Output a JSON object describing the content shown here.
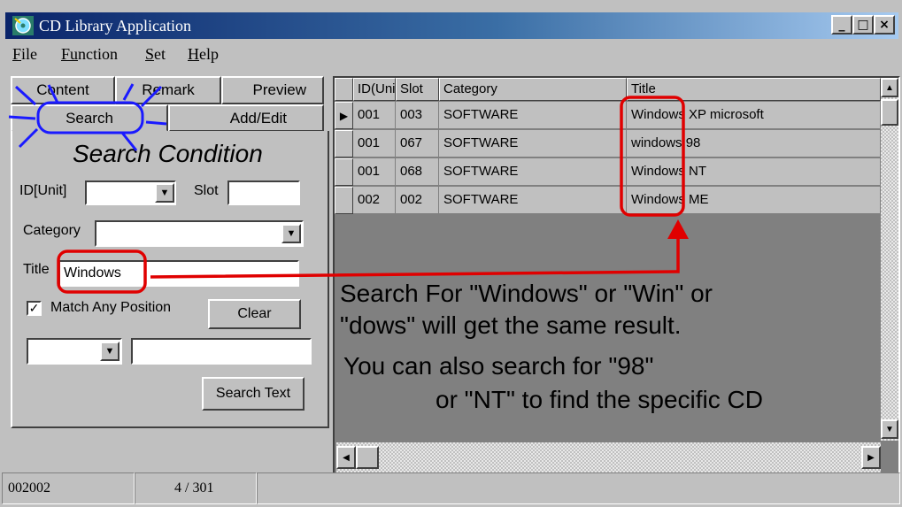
{
  "window": {
    "title": "CD Library Application",
    "buttons": {
      "minimize": "_",
      "maximize": "□",
      "close": "×"
    }
  },
  "menu": {
    "items": [
      {
        "underline": "F",
        "rest": "ile"
      },
      {
        "underline": "Fu",
        "rest": "nction"
      },
      {
        "underline": "S",
        "rest": "et"
      },
      {
        "underline": "H",
        "rest": "elp"
      }
    ]
  },
  "tabs": {
    "content": "Content",
    "remark": "Remark",
    "preview": "Preview",
    "search": "Search",
    "add_edit": "Add/Edit"
  },
  "search_panel": {
    "heading": "Search Condition",
    "id_unit_label": "ID[Unit]",
    "id_unit_value": "",
    "slot_label": "Slot",
    "slot_value": "",
    "category_label": "Category",
    "category_value": "",
    "title_label": "Title",
    "title_value": "Windows",
    "match_any_label": "Match Any Position",
    "match_any_checked": true,
    "clear_button": "Clear",
    "extra_combo_value": "",
    "extra_text_value": "",
    "search_text_button": "Search Text"
  },
  "grid": {
    "columns": [
      "ID(Unit)",
      "Slot",
      "Category",
      "Title"
    ],
    "rows": [
      {
        "id": "001",
        "slot": "003",
        "category": "SOFTWARE",
        "title": "Windows XP microsoft"
      },
      {
        "id": "001",
        "slot": "067",
        "category": "SOFTWARE",
        "title": "windows 98"
      },
      {
        "id": "001",
        "slot": "068",
        "category": "SOFTWARE",
        "title": "Windows NT"
      },
      {
        "id": "002",
        "slot": "002",
        "category": "SOFTWARE",
        "title": "Windows ME"
      }
    ],
    "current_row_marker": "▶"
  },
  "annotation": {
    "line1": "Search For \"Windows\" or \"Win\" or",
    "line2": "\"dows\" will get the same result.",
    "line3": "You can  also search for \"98\"",
    "line4": "or \"NT\" to find the specific CD"
  },
  "statusbar": {
    "record_id": "002002",
    "position": "4 / 301"
  },
  "colors": {
    "titlebar_start": "#0a246a",
    "titlebar_end": "#a6caf0",
    "highlight_red": "#e00000",
    "highlight_blue": "#1a1aff"
  }
}
